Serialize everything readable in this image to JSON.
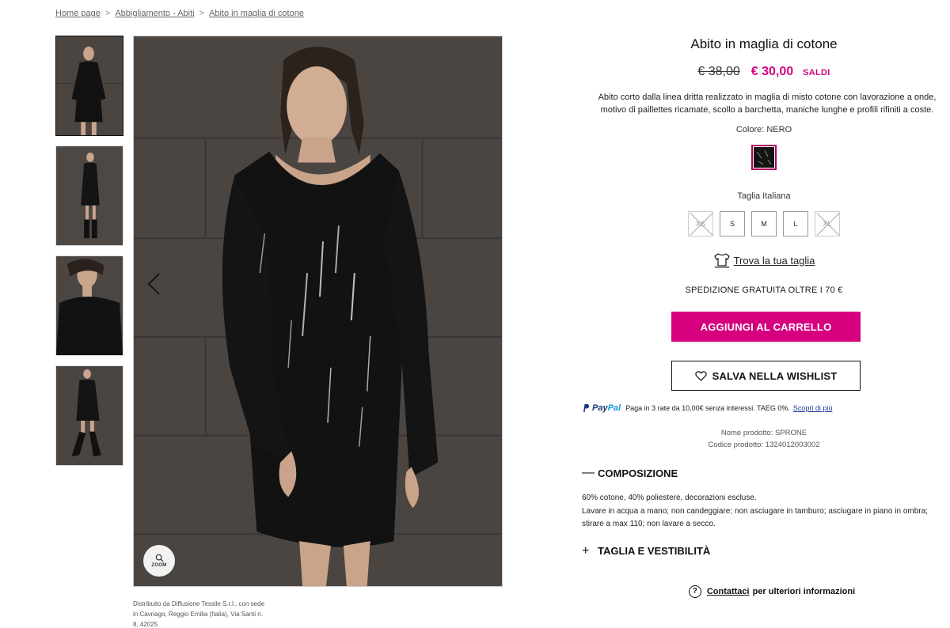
{
  "breadcrumb": {
    "items": [
      "Home page",
      "Abbigliamento - Abiti",
      "Abito in maglia di cotone"
    ]
  },
  "gallery": {
    "thumb_count": 4,
    "zoom_label": "ZOOM",
    "distributor_note": "Distribuito da Diffusione Tessile S.r.l., con sede in Cavriago, Reggio Emilia (Italia), Via Santi n. 8, 42025"
  },
  "product": {
    "title": "Abito in maglia di cotone",
    "old_price": "€ 38,00",
    "new_price": "€ 30,00",
    "sale_label": "SALDI",
    "description": "Abito corto dalla linea dritta realizzato in maglia di misto cotone con lavorazione a onde, motivo di paillettes ricamate, scollo a barchetta, maniche lunghe e profili rifiniti a coste.",
    "color_label": "Colore: NERO",
    "size_system": "Taglia Italiana",
    "sizes": [
      {
        "label": "XS",
        "available": false
      },
      {
        "label": "S",
        "available": true
      },
      {
        "label": "M",
        "available": true
      },
      {
        "label": "L",
        "available": true
      },
      {
        "label": "XL",
        "available": false
      }
    ],
    "fit_link": "Trova la tua taglia",
    "shipping": "SPEDIZIONE GRATUITA OLTRE I 70 €",
    "add_to_cart": "AGGIUNGI AL CARRELLO",
    "wishlist": "SALVA NELLA WISHLIST",
    "paypal": {
      "brand_a": "Pay",
      "brand_b": "Pal",
      "text": "Paga in 3 rate da 10,00€ senza interessi. TAEG 0%.",
      "link": "Scopri di più"
    },
    "product_name": "Nome prodotto: SPRONE",
    "product_code": "Codice prodotto:  1324012003002",
    "composition": {
      "title": "COMPOSIZIONE",
      "line1": "60% cotone, 40% poliestere, decorazioni escluse.",
      "line2": "Lavare in acqua a mano; non candeggiare; non asciugare in tamburo; asciugare in piano in ombra; stirare a max 110; non lavare a secco."
    },
    "fit_section": "TAGLIA E VESTIBILITÀ",
    "contact_link": "Contattaci",
    "contact_text": "per ulteriori informazioni"
  },
  "colors": {
    "accent": "#d6007e",
    "selected_swatch_border": "#b0005f"
  },
  "icons": {
    "prev": "chevron-left-icon",
    "next": "chevron-right-icon",
    "zoom": "search-icon",
    "fit": "tshirt-ruler-icon",
    "wishlist": "heart-icon",
    "contact": "question-icon"
  }
}
